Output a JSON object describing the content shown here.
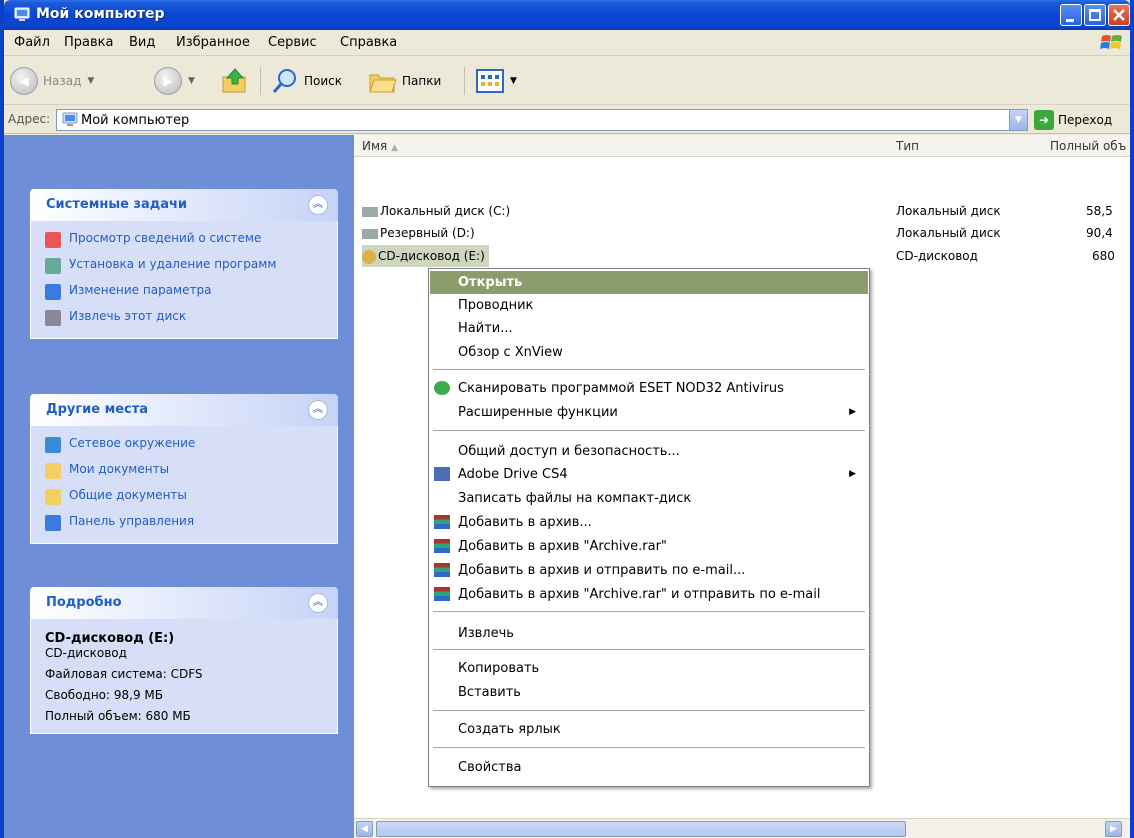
{
  "window": {
    "title": "Мой компьютер"
  },
  "menubar": {
    "items": [
      "Файл",
      "Правка",
      "Вид",
      "Избранное",
      "Сервис",
      "Справка"
    ]
  },
  "toolbar": {
    "back_label": "Назад",
    "search_label": "Поиск",
    "folders_label": "Папки"
  },
  "address": {
    "label": "Адрес:",
    "value": "Мой компьютер",
    "go_label": "Переход"
  },
  "tasks_panel": {
    "title": "Системные задачи",
    "items": [
      "Просмотр сведений о системе",
      "Установка и удаление программ",
      "Изменение параметра",
      "Извлечь этот диск"
    ]
  },
  "places_panel": {
    "title": "Другие места",
    "items": [
      "Сетевое окружение",
      "Мои документы",
      "Общие документы",
      "Панель управления"
    ]
  },
  "details_panel": {
    "title": "Подробно",
    "name": "CD-дисковод (E:)",
    "type": "CD-дисковод",
    "filesystem": "Файловая система: CDFS",
    "free": "Свободно: 98,9 МБ",
    "total": "Полный объем: 680 МБ"
  },
  "list": {
    "columns": [
      "Имя",
      "Тип",
      "Полный объ"
    ],
    "rows": [
      {
        "name": "Локальный диск (C:)",
        "type": "Локальный диск",
        "size": "58,5"
      },
      {
        "name": "Резервный (D:)",
        "type": "Локальный диск",
        "size": "90,4"
      },
      {
        "name": "CD-дисковод (E:)",
        "type": "CD-дисковод",
        "size": "680"
      }
    ]
  },
  "context_menu": {
    "items": [
      "Открыть",
      "Проводник",
      "Найти...",
      "Обзор с XnView",
      "Сканировать программой ESET NOD32 Antivirus",
      "Расширенные функции",
      "Общий доступ и безопасность...",
      "Adobe Drive CS4",
      "Записать файлы на компакт-диск",
      "Добавить в архив...",
      "Добавить в архив \"Archive.rar\"",
      "Добавить в архив и отправить по e-mail...",
      "Добавить в архив \"Archive.rar\" и отправить по e-mail",
      "Извлечь",
      "Копировать",
      "Вставить",
      "Создать ярлык",
      "Свойства"
    ]
  },
  "colors": {
    "titlebar": "#0a46d6",
    "taskpane": "#6e8fd8",
    "menu_highlight": "#8c9d6b"
  }
}
